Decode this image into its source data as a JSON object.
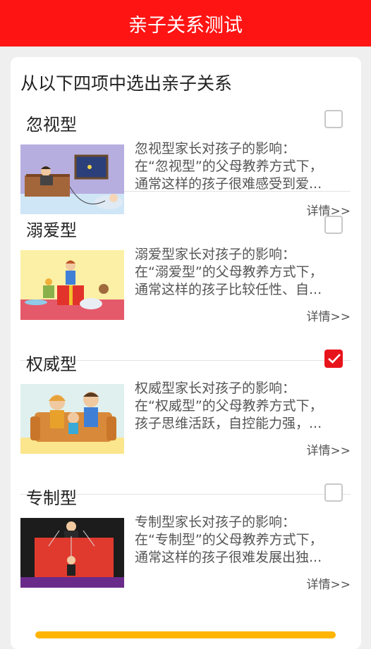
{
  "header": {
    "title": "亲子关系测试"
  },
  "question": {
    "prompt": "从以下四项中选出亲子关系"
  },
  "options": [
    {
      "title": "忽视型",
      "checked": false,
      "desc_line1": "忽视型家长对孩子的影响：",
      "desc_line2": "在“忽视型”的父母教养方式下，",
      "desc_line3": "通常这样的孩子很难感受到爱...",
      "more": "详情>>",
      "image_icon": "neglect-illustration"
    },
    {
      "title": "溺爱型",
      "checked": false,
      "desc_line1": "溺爱型家长对孩子的影响：",
      "desc_line2": "在“溺爱型”的父母教养方式下，",
      "desc_line3": "通常这样的孩子比较任性、自...",
      "more": "详情>>",
      "image_icon": "spoil-illustration"
    },
    {
      "title": "权威型",
      "checked": true,
      "desc_line1": "权威型家长对孩子的影响：",
      "desc_line2": "在“权威型”的父母教养方式下，",
      "desc_line3": "孩子思维活跃，自控能力强，...",
      "more": "详情>>",
      "image_icon": "authoritative-illustration"
    },
    {
      "title": "专制型",
      "checked": false,
      "desc_line1": "专制型家长对孩子的影响：",
      "desc_line2": "在“专制型”的父母教养方式下，",
      "desc_line3": "通常这样的孩子很难发展出独...",
      "more": "详情>>",
      "image_icon": "authoritarian-illustration"
    }
  ],
  "colors": {
    "header_bg": "#ff1414",
    "checked": "#e8141c",
    "page_bg": "#efefef"
  }
}
